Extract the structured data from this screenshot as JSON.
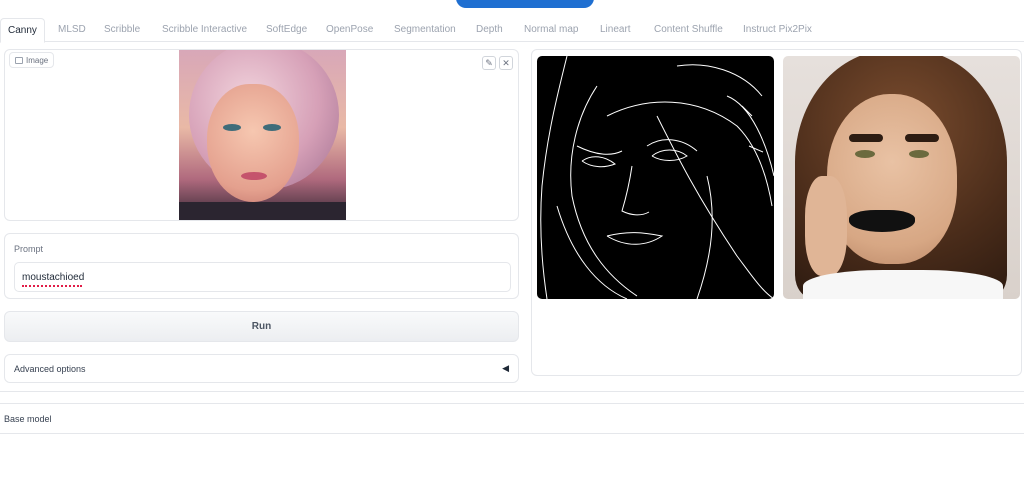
{
  "tabs": [
    {
      "label": "Canny",
      "active": true
    },
    {
      "label": "MLSD"
    },
    {
      "label": "Scribble"
    },
    {
      "label": "Scribble Interactive"
    },
    {
      "label": "SoftEdge"
    },
    {
      "label": "OpenPose"
    },
    {
      "label": "Segmentation"
    },
    {
      "label": "Depth"
    },
    {
      "label": "Normal map"
    },
    {
      "label": "Lineart"
    },
    {
      "label": "Content Shuffle"
    },
    {
      "label": "Instruct Pix2Pix"
    }
  ],
  "image_input": {
    "label": "Image",
    "edit_icon": "pencil-icon",
    "clear_icon": "close-icon"
  },
  "prompt": {
    "label": "Prompt",
    "value": "moustachioed"
  },
  "run": {
    "label": "Run"
  },
  "advanced": {
    "label": "Advanced options",
    "arrow_icon": "triangle-left-icon"
  },
  "gallery": {
    "share_icon": "share-icon"
  },
  "base_model": {
    "label": "Base model"
  },
  "colors": {
    "accent": "#1f6fd1",
    "border": "#e5e7eb"
  }
}
